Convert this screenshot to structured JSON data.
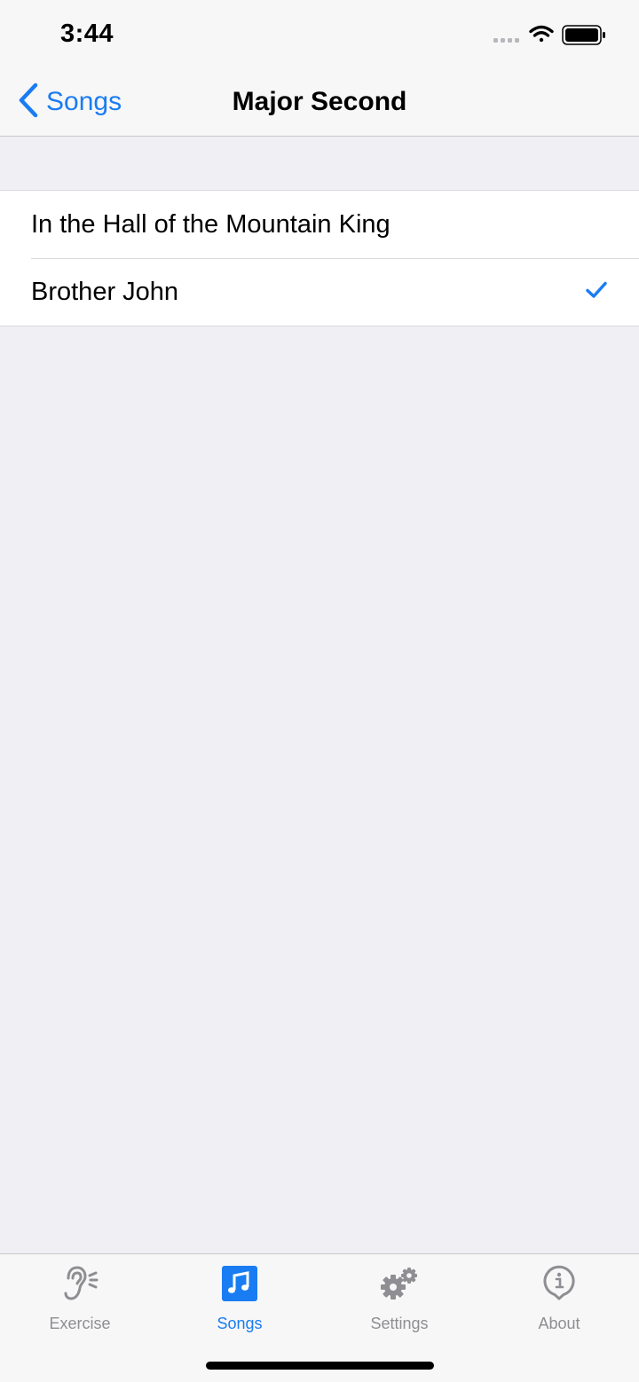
{
  "status_bar": {
    "time": "3:44",
    "icons": [
      "signal-dots-icon",
      "wifi-icon",
      "battery-icon"
    ]
  },
  "nav": {
    "back_label": "Songs",
    "title": "Major Second"
  },
  "songs": [
    {
      "title": "In the Hall of the Mountain King",
      "selected": false
    },
    {
      "title": "Brother John",
      "selected": true
    }
  ],
  "tabs": [
    {
      "label": "Exercise",
      "icon": "ear-icon",
      "active": false
    },
    {
      "label": "Songs",
      "icon": "music-note-icon",
      "active": true
    },
    {
      "label": "Settings",
      "icon": "gears-icon",
      "active": false
    },
    {
      "label": "About",
      "icon": "info-icon",
      "active": false
    }
  ],
  "colors": {
    "accent": "#1a7cf2",
    "inactive": "#8e8e93",
    "background": "#efeff4"
  }
}
